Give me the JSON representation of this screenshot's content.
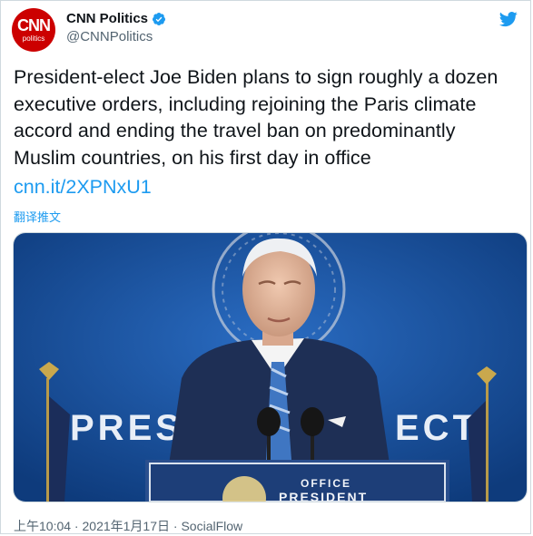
{
  "account": {
    "avatar_main": "CNN",
    "avatar_sub": "politics",
    "display_name": "CNN Politics",
    "handle": "@CNNPolitics"
  },
  "tweet": {
    "line1": "President-elect Joe Biden plans to sign roughly a dozen",
    "line2": "executive orders, including rejoining the Paris climate",
    "line3": "accord and ending the travel ban on predominantly",
    "line4": "Muslim countries, on his first day in office",
    "link": "cnn.it/2XPNxU1",
    "translate": "翻译推文"
  },
  "image": {
    "backdrop_left": "PRES",
    "backdrop_right": "ECT",
    "podium_line1": "OFFICE",
    "podium_line2": "PRESIDENT"
  },
  "meta": {
    "time": "上午10:04",
    "separator": " · ",
    "date": "2021年1月17日",
    "source": "SocialFlow"
  },
  "colors": {
    "brand_red": "#cc0000",
    "link_blue": "#1d9bf0",
    "meta_gray": "#536471",
    "backdrop_blue": "#1f5aa8"
  }
}
